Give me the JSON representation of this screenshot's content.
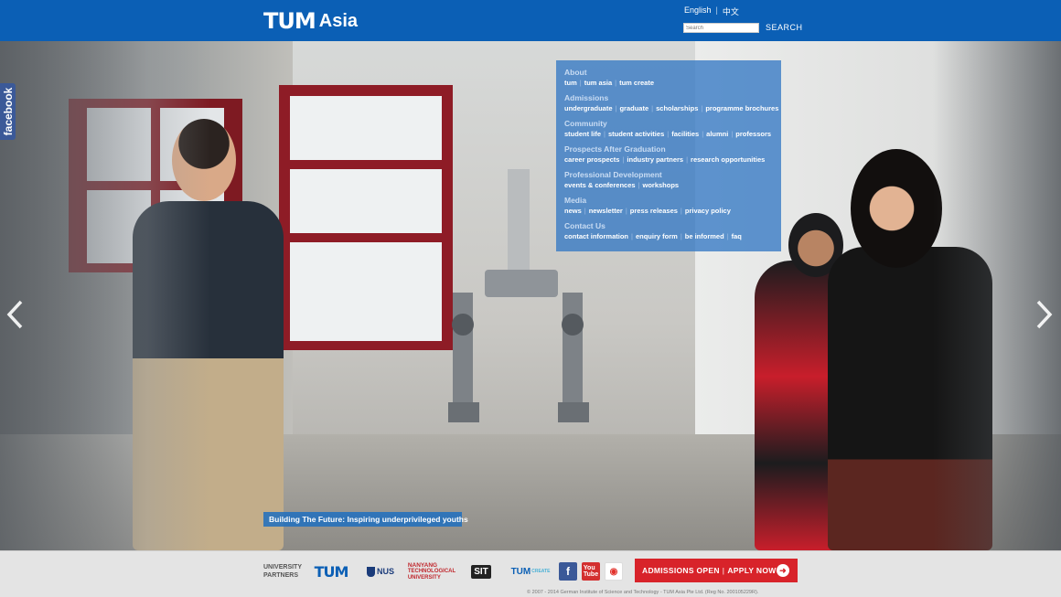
{
  "header": {
    "logo_mark": "TUM",
    "logo_text": "Asia",
    "lang_english": "English",
    "lang_chinese": "中文",
    "search_placeholder": "Search",
    "search_button": "SEARCH"
  },
  "sidebar_tab": {
    "label": "facebook"
  },
  "menu": [
    {
      "title": "About",
      "links": [
        "tum",
        "tum asia",
        "tum create"
      ]
    },
    {
      "title": "Admissions",
      "links": [
        "undergraduate",
        "graduate",
        "scholarships",
        "programme brochures"
      ]
    },
    {
      "title": "Community",
      "links": [
        "student life",
        "student activities",
        "facilities",
        "alumni",
        "professors"
      ]
    },
    {
      "title": "Prospects After Graduation",
      "links": [
        "career prospects",
        "industry partners",
        "research opportunities"
      ]
    },
    {
      "title": "Professional Development",
      "links": [
        "events & conferences",
        "workshops"
      ]
    },
    {
      "title": "Media",
      "links": [
        "news",
        "newsletter",
        "press releases",
        "privacy policy"
      ]
    },
    {
      "title": "Contact Us",
      "links": [
        "contact information",
        "enquiry form",
        "be informed",
        "faq"
      ]
    }
  ],
  "slider": {
    "caption": "Building The Future: Inspiring underprivileged youths"
  },
  "footer": {
    "partners_label_1": "UNIVERSITY",
    "partners_label_2": "PARTNERS",
    "partner_tum": "TUM",
    "partner_nus": "NUS",
    "partner_ntu_1": "NANYANG",
    "partner_ntu_2": "TECHNOLOGICAL",
    "partner_ntu_3": "UNIVERSITY",
    "partner_sit": "SIT",
    "partner_create": "TUM",
    "partner_create_suffix": "CREATE",
    "admissions_open": "ADMISSIONS OPEN",
    "apply_now": "APPLY NOW",
    "copyright": "© 2007 - 2014 German Institute of Science and Technology - TUM Asia Pte Ltd. (Reg No. 200105229R)."
  },
  "colors": {
    "brand_blue": "#0b5fb5",
    "menu_overlay": "#3478c4",
    "admissions_red": "#d8232a"
  }
}
